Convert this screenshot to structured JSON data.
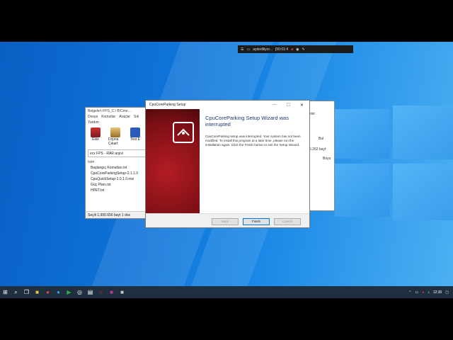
{
  "recorder_bar": {
    "label": "aydediliyor...",
    "time": "[00:01:4"
  },
  "winrar": {
    "title": "Belgeler\\ FPS_C:\\ B\\Cme...",
    "menu": [
      "Dosya",
      "Komutlar",
      "Araçlar",
      "Sık"
    ],
    "menu2": "Yardım",
    "tools": [
      "Ekle",
      "Dışına Çıkart",
      "Test E"
    ],
    "path": "ecx FPS - RAR arşivi",
    "column": "İsim",
    "files": [
      "Başlangıç Komutları.txt",
      "CpuCoreParkingSetup-2.1.1.0",
      "CpuQuickSetup-1.0.1.0.msi",
      "Güç Planı.txt",
      "HPET.txt"
    ],
    "status": "Seçili 1.990.656 bayt 1 dos"
  },
  "right_window": {
    "label": "Bul",
    "size": "5.262 bayt",
    "col": "Boyu",
    "top": "kler"
  },
  "setup": {
    "title": "CpuCoreParking Setup",
    "heading": "CpuCoreParking Setup Wizard was interrupted",
    "body": "CpuCoreParking setup was interrupted. Your system has not been modified. To install this program at a later time, please run the installation again. Click the Finish button to exit the Setup Wizard.",
    "back": "Back",
    "finish": "Finish",
    "cancel": "Cancel"
  },
  "taskbar": {
    "time": "12:30"
  }
}
